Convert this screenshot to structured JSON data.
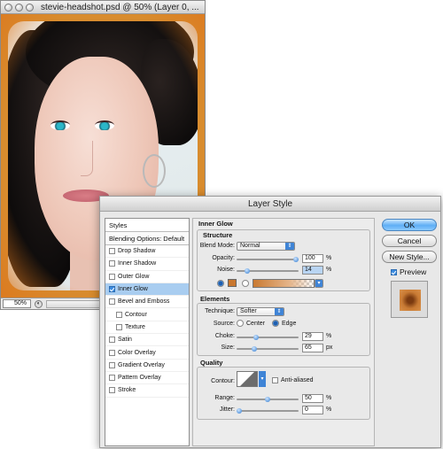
{
  "document": {
    "title": "stevie-headshot.psd @ 50% (Layer 0, ...",
    "zoom": "50%",
    "glow_color": "#d88c2e"
  },
  "dialog": {
    "title": "Layer Style",
    "styles_header": "Styles",
    "blending_options": "Blending Options: Default",
    "styles": [
      {
        "label": "Drop Shadow",
        "checked": false
      },
      {
        "label": "Inner Shadow",
        "checked": false
      },
      {
        "label": "Outer Glow",
        "checked": false
      },
      {
        "label": "Inner Glow",
        "checked": true,
        "selected": true
      },
      {
        "label": "Bevel and Emboss",
        "checked": false
      },
      {
        "label": "Contour",
        "checked": false,
        "sub": true
      },
      {
        "label": "Texture",
        "checked": false,
        "sub": true
      },
      {
        "label": "Satin",
        "checked": false
      },
      {
        "label": "Color Overlay",
        "checked": false
      },
      {
        "label": "Gradient Overlay",
        "checked": false
      },
      {
        "label": "Pattern Overlay",
        "checked": false
      },
      {
        "label": "Stroke",
        "checked": false
      }
    ],
    "section_title": "Inner Glow",
    "structure": {
      "title": "Structure",
      "blend_mode_label": "Blend Mode:",
      "blend_mode": "Normal",
      "opacity_label": "Opacity:",
      "opacity": "100",
      "opacity_unit": "%",
      "opacity_level": 1.0,
      "noise_label": "Noise:",
      "noise": "14",
      "noise_unit": "%",
      "noise_level": 0.14
    },
    "elements": {
      "title": "Elements",
      "technique_label": "Technique:",
      "technique": "Softer",
      "source_label": "Source:",
      "center_label": "Center",
      "edge_label": "Edge",
      "choke_label": "Choke:",
      "choke": "29",
      "choke_unit": "%",
      "choke_level": 0.29,
      "size_label": "Size:",
      "size": "65",
      "size_unit": "px",
      "size_level": 0.26
    },
    "quality": {
      "title": "Quality",
      "contour_label": "Contour:",
      "anti_aliased_label": "Anti-aliased",
      "range_label": "Range:",
      "range": "50",
      "range_unit": "%",
      "range_level": 0.5,
      "jitter_label": "Jitter:",
      "jitter": "0",
      "jitter_unit": "%",
      "jitter_level": 0.0
    },
    "buttons": {
      "ok": "OK",
      "cancel": "Cancel",
      "new_style": "New Style...",
      "preview": "Preview"
    }
  }
}
